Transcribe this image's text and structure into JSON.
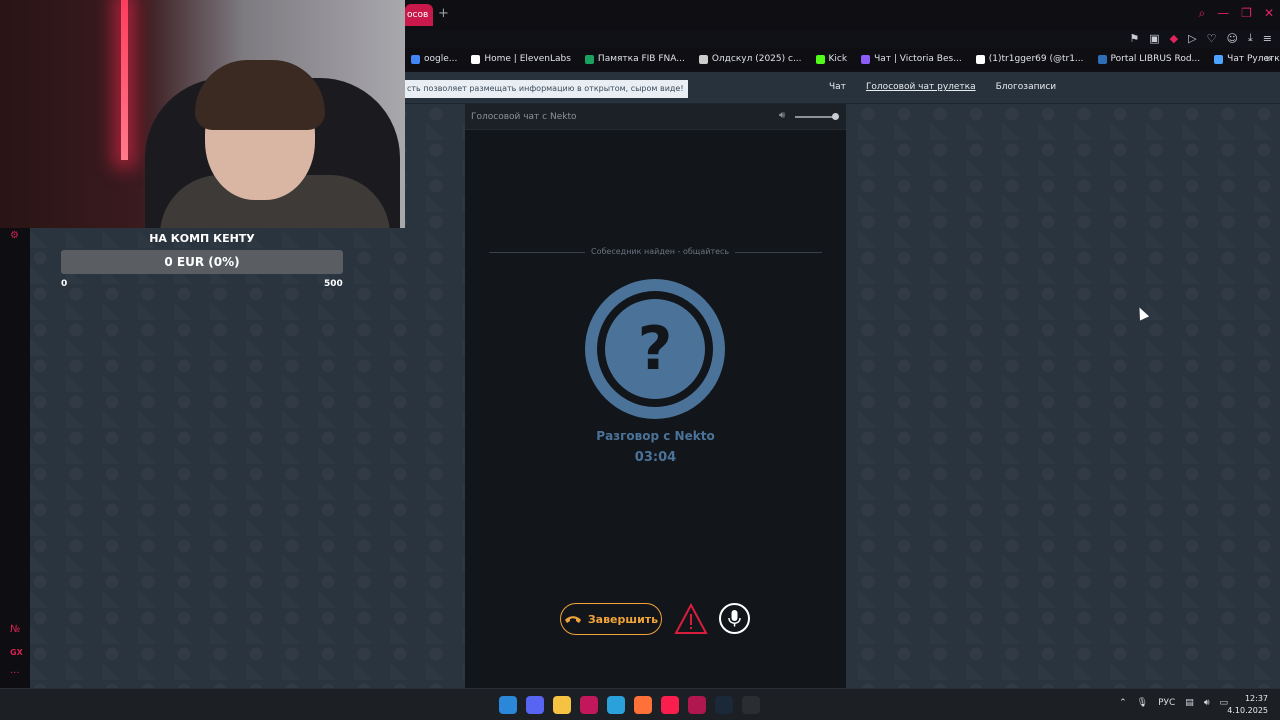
{
  "browser": {
    "active_tab_label": "осов",
    "new_tab_symbol": "+",
    "bookmarks": [
      {
        "label": "oogle...",
        "color": "#4285f4"
      },
      {
        "label": "Home | ElevenLabs",
        "color": "#ffffff"
      },
      {
        "label": "Памятка FIB FNA...",
        "color": "#1aa260"
      },
      {
        "label": "Олдскул (2025) с...",
        "color": "#cccccc"
      },
      {
        "label": "Kick",
        "color": "#53fc18"
      },
      {
        "label": "Чат | Victoria Bes...",
        "color": "#8b5cf6"
      },
      {
        "label": "(1)tr1gger69 (@tr1...",
        "color": "#ffffff"
      },
      {
        "label": "Portal LIBRUS Rod...",
        "color": "#2c6fb7"
      },
      {
        "label": "Чат Рулетка — бе...",
        "color": "#4da3ff"
      }
    ],
    "bookmarks_more_symbol": "»"
  },
  "site": {
    "notice": "сть позволяет размещать информацию в открытом, сыром виде!",
    "nav": {
      "chat": "Чат",
      "voice_roulette": "Голосовой чат рулетка",
      "blog": "Блогозаписи"
    }
  },
  "donation_goal": {
    "title": "НА КОМП КЕНТУ",
    "amount_text": "0 EUR (0%)",
    "progress_fraction": 0,
    "min": "0",
    "max": "500",
    "accent": "#cf2b55"
  },
  "voice_chat": {
    "title": "Голосовой чат с Nekto",
    "volume_fraction": 1.0,
    "status": "Собеседник найден - общайтесь",
    "avatar_symbol": "?",
    "conversation_label": "Разговор с Nekto",
    "timer": "03:04",
    "end_button_label": "Завершить",
    "accent_end": "#f2a33a",
    "accent_avatar": "#4b7399",
    "report_color": "#d81e3c"
  },
  "left_strip": {
    "icons": [
      "gear-icon",
      "gx-icon",
      "more-icon"
    ],
    "gx_label": "GX",
    "more_label": "···"
  },
  "taskbar": {
    "apps": [
      {
        "name": "windows-start-icon",
        "color": "#2b88d8"
      },
      {
        "name": "discord-icon",
        "color": "#5865f2"
      },
      {
        "name": "file-explorer-icon",
        "color": "#f5c242"
      },
      {
        "name": "app-icon-1",
        "color": "#c2185b"
      },
      {
        "name": "telegram-icon",
        "color": "#2aa1da"
      },
      {
        "name": "firefox-icon",
        "color": "#ff7139"
      },
      {
        "name": "opera-gx-icon",
        "color": "#fa1e4e"
      },
      {
        "name": "app-icon-2",
        "color": "#b0174e"
      },
      {
        "name": "steam-icon",
        "color": "#1b2838"
      },
      {
        "name": "obs-icon",
        "color": "#2b2d31"
      }
    ],
    "language": "РУС",
    "time": "12:37",
    "date": "4.10.2025"
  }
}
